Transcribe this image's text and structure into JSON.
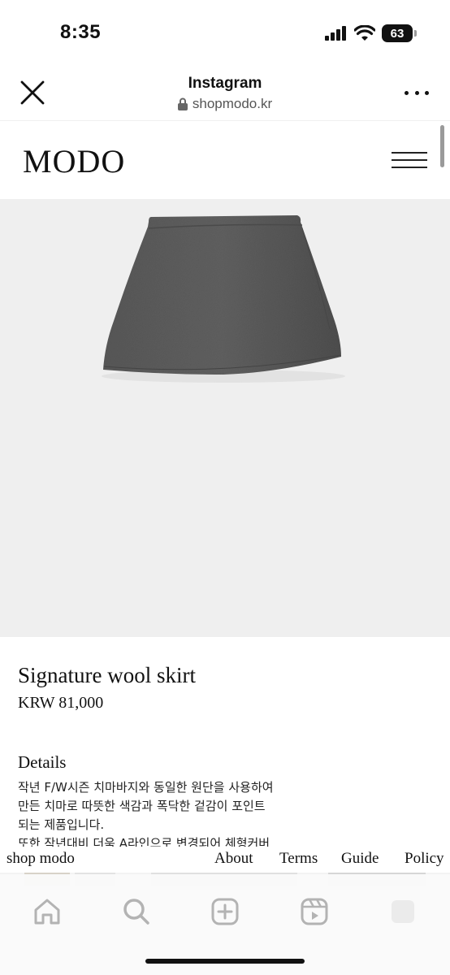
{
  "status_bar": {
    "time": "8:35",
    "battery": "63",
    "icons": [
      "signal-icon",
      "wifi-icon",
      "battery-icon"
    ]
  },
  "browser": {
    "title": "Instagram",
    "url": "shopmodo.kr",
    "icons": [
      "close-icon",
      "lock-icon",
      "more-icon"
    ]
  },
  "site": {
    "logo": "MODO",
    "menu_icon": "hamburger-menu-icon"
  },
  "product": {
    "image_description_icon": "skirt-image",
    "name": "Signature wool skirt",
    "price": "KRW 81,000",
    "details_heading": "Details",
    "details_lines": [
      "작년 F/W시즌 치마바지와 동일한 원단을 사용하여",
      "만든 치마로 따뜻한 색감과 폭닥한 겉감이 포인트",
      "되는 제품입니다.",
      "또한 작년대비 더욱 A라인으로 변경되어 체형커버"
    ]
  },
  "footer": {
    "shop": "shop modo",
    "about": "About",
    "terms": "Terms",
    "guide": "Guide",
    "policy": "Policy"
  },
  "tab_bar": {
    "tabs": [
      "home-icon",
      "search-icon",
      "create-icon",
      "reels-icon",
      "profile-icon"
    ]
  },
  "colors": {
    "image_bg": "#efefef",
    "skirt": "#5a5a5a"
  }
}
